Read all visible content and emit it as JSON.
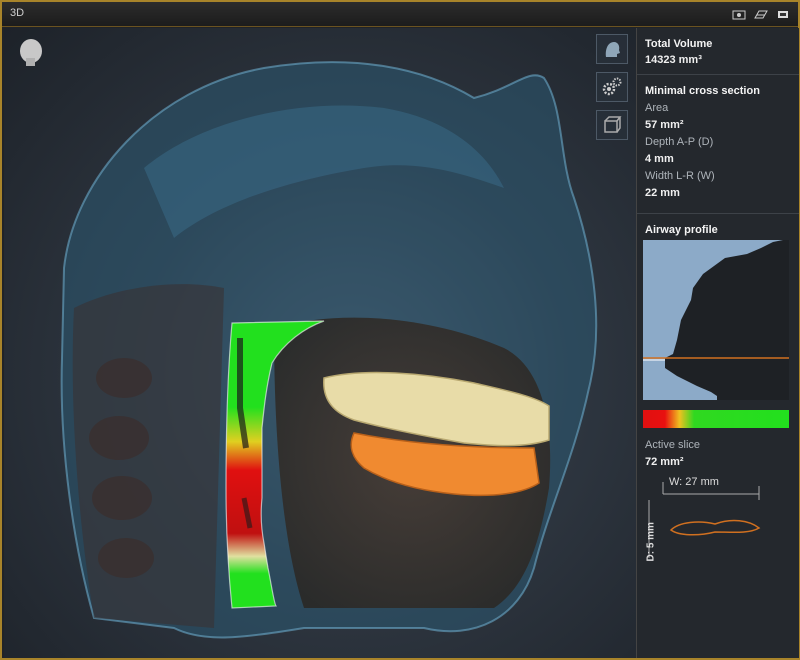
{
  "window": {
    "title": "3D"
  },
  "view_tools": [
    {
      "name": "view-presets",
      "icon": "head-profile-icon"
    },
    {
      "name": "settings",
      "icon": "gear-icon"
    },
    {
      "name": "clip-box",
      "icon": "cube-icon"
    }
  ],
  "panel": {
    "total_volume": {
      "label": "Total Volume",
      "value": "14323 mm³"
    },
    "min_cross_section": {
      "heading": "Minimal cross section",
      "area_label": "Area",
      "area_value": "57 mm²",
      "depth_label": "Depth A-P (D)",
      "depth_value": "4 mm",
      "width_label": "Width L-R (W)",
      "width_value": "22 mm"
    },
    "airway_profile": {
      "heading": "Airway profile"
    },
    "active_slice": {
      "label": "Active slice",
      "value": "72 mm²",
      "width_measure": "W: 27 mm",
      "depth_measure": "D: 5 mm"
    }
  },
  "colors": {
    "accent": "#a8842a",
    "airway_green": "#22e01e",
    "airway_yellow": "#e0d020",
    "airway_red": "#e01010",
    "upper_teeth": "#e8dca8",
    "lower_teeth": "#f08a30",
    "profile_fill": "#8caac8",
    "active_line": "#d07020"
  }
}
